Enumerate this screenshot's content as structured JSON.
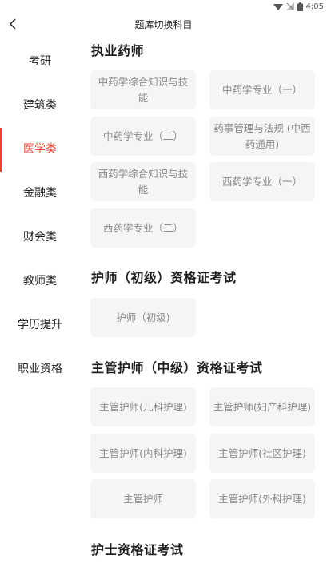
{
  "status": {
    "time": "4:05",
    "icons": [
      "signal-icon",
      "wifi-off-icon",
      "battery-icon"
    ]
  },
  "header": {
    "back_icon": "chevron-left-icon",
    "title": "题库切换科目"
  },
  "sidebar": {
    "active_color": "#e8432f",
    "items": [
      {
        "label": "考研"
      },
      {
        "label": "建筑类"
      },
      {
        "label": "医学类",
        "active": true
      },
      {
        "label": "金融类"
      },
      {
        "label": "财会类"
      },
      {
        "label": "教师类"
      },
      {
        "label": "学历提升"
      },
      {
        "label": "职业资格"
      }
    ]
  },
  "sections": [
    {
      "title": "执业药师",
      "subjects": [
        "中药学综合知识与技能",
        "中药学专业（一）",
        "中药学专业（二）",
        "药事管理与法规 (中西药通用)",
        "西药学综合知识与技能",
        "西药学专业（一）",
        "西药学专业（二）"
      ]
    },
    {
      "title": "护师（初级）资格证考试",
      "subjects": [
        "护师（初级)"
      ]
    },
    {
      "title": "主管护师（中级）资格证考试",
      "subjects": [
        "主管护师(儿科护理)",
        "主管护师(妇产科护理)",
        "主管护师(内科护理)",
        "主管护师(社区护理)",
        "主管护师",
        "主管护师(外科护理)"
      ]
    },
    {
      "title": "护士资格证考试",
      "subjects": []
    }
  ]
}
